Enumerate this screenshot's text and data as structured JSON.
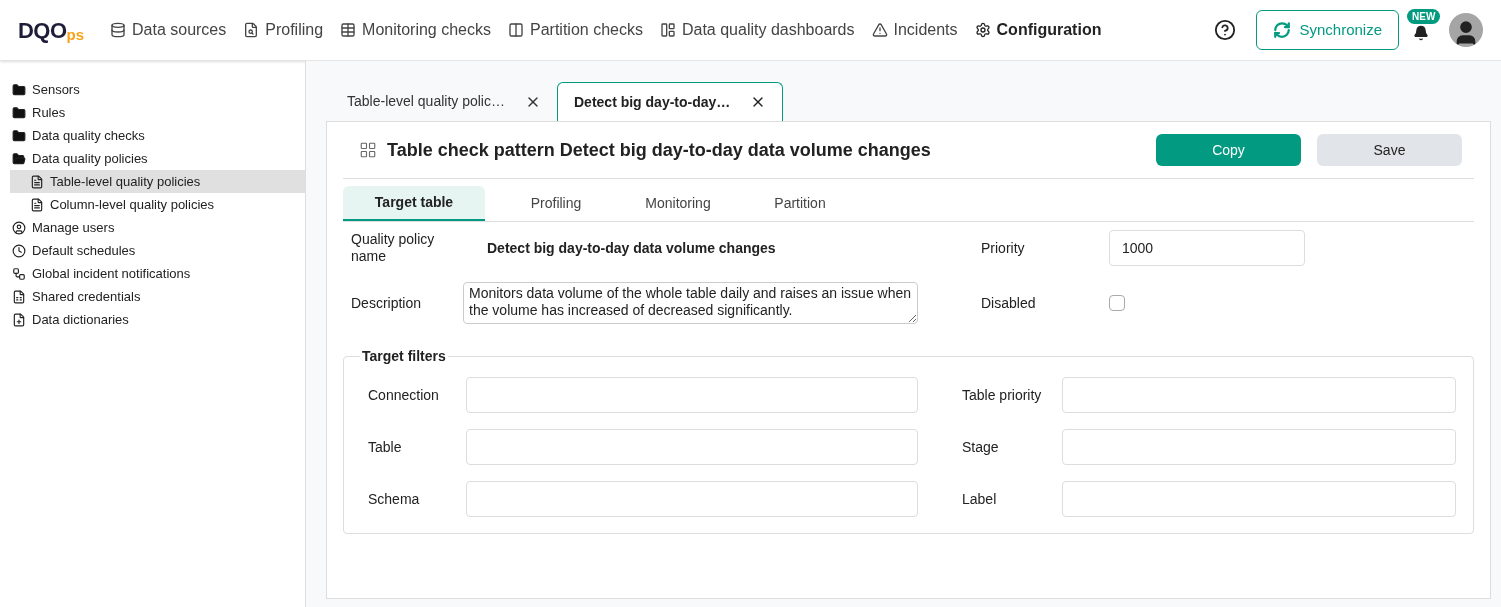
{
  "header": {
    "logo": {
      "main": "DQO",
      "suffix": "ps"
    },
    "nav": [
      {
        "label": "Data sources",
        "selected": false
      },
      {
        "label": "Profiling",
        "selected": false
      },
      {
        "label": "Monitoring checks",
        "selected": false
      },
      {
        "label": "Partition checks",
        "selected": false
      },
      {
        "label": "Data quality dashboards",
        "selected": false
      },
      {
        "label": "Incidents",
        "selected": false
      },
      {
        "label": "Configuration",
        "selected": true
      }
    ],
    "sync_button": "Synchronize",
    "notification_badge": "NEW"
  },
  "sidebar": {
    "items": [
      {
        "label": "Sensors",
        "kind": "folder",
        "expanded": false,
        "selected": false
      },
      {
        "label": "Rules",
        "kind": "folder",
        "expanded": false,
        "selected": false
      },
      {
        "label": "Data quality checks",
        "kind": "folder",
        "expanded": false,
        "selected": false
      },
      {
        "label": "Data quality policies",
        "kind": "folder",
        "expanded": true,
        "selected": false,
        "children": [
          {
            "label": "Table-level quality policies",
            "kind": "policy",
            "selected": true
          },
          {
            "label": "Column-level quality policies",
            "kind": "policy",
            "selected": false
          }
        ]
      },
      {
        "label": "Manage users",
        "kind": "users",
        "selected": false
      },
      {
        "label": "Default schedules",
        "kind": "schedule",
        "selected": false
      },
      {
        "label": "Global incident notifications",
        "kind": "notifications",
        "selected": false
      },
      {
        "label": "Shared credentials",
        "kind": "credentials",
        "selected": false
      },
      {
        "label": "Data dictionaries",
        "kind": "dictionary",
        "selected": false
      }
    ]
  },
  "editor_tabs": [
    {
      "label": "Table-level quality polic…",
      "selected": false
    },
    {
      "label": "Detect big day-to-day…",
      "selected": true
    }
  ],
  "page": {
    "title": "Table check pattern Detect big day-to-day data volume changes",
    "buttons": [
      {
        "label": "Copy",
        "kind": "primary"
      },
      {
        "label": "Save",
        "kind": "secondary"
      }
    ],
    "tabs": [
      {
        "label": "Target table",
        "selected": true
      },
      {
        "label": "Profiling",
        "selected": false
      },
      {
        "label": "Monitoring",
        "selected": false
      },
      {
        "label": "Partition",
        "selected": false
      }
    ],
    "form": {
      "name_label": "Quality policy name",
      "name_value": "Detect big day-to-day data volume changes",
      "description_label": "Description",
      "description_value": "Monitors data volume of the whole table daily and raises an issue when the volume has increased of decreased significantly.",
      "priority_label": "Priority",
      "priority_value": "1000",
      "disabled_label": "Disabled",
      "disabled_checked": false
    },
    "target_filters": {
      "legend": "Target filters",
      "fields": [
        {
          "label": "Connection"
        },
        {
          "label": "Table priority"
        },
        {
          "label": "Table"
        },
        {
          "label": "Stage"
        },
        {
          "label": "Schema"
        },
        {
          "label": "Label"
        }
      ]
    }
  }
}
